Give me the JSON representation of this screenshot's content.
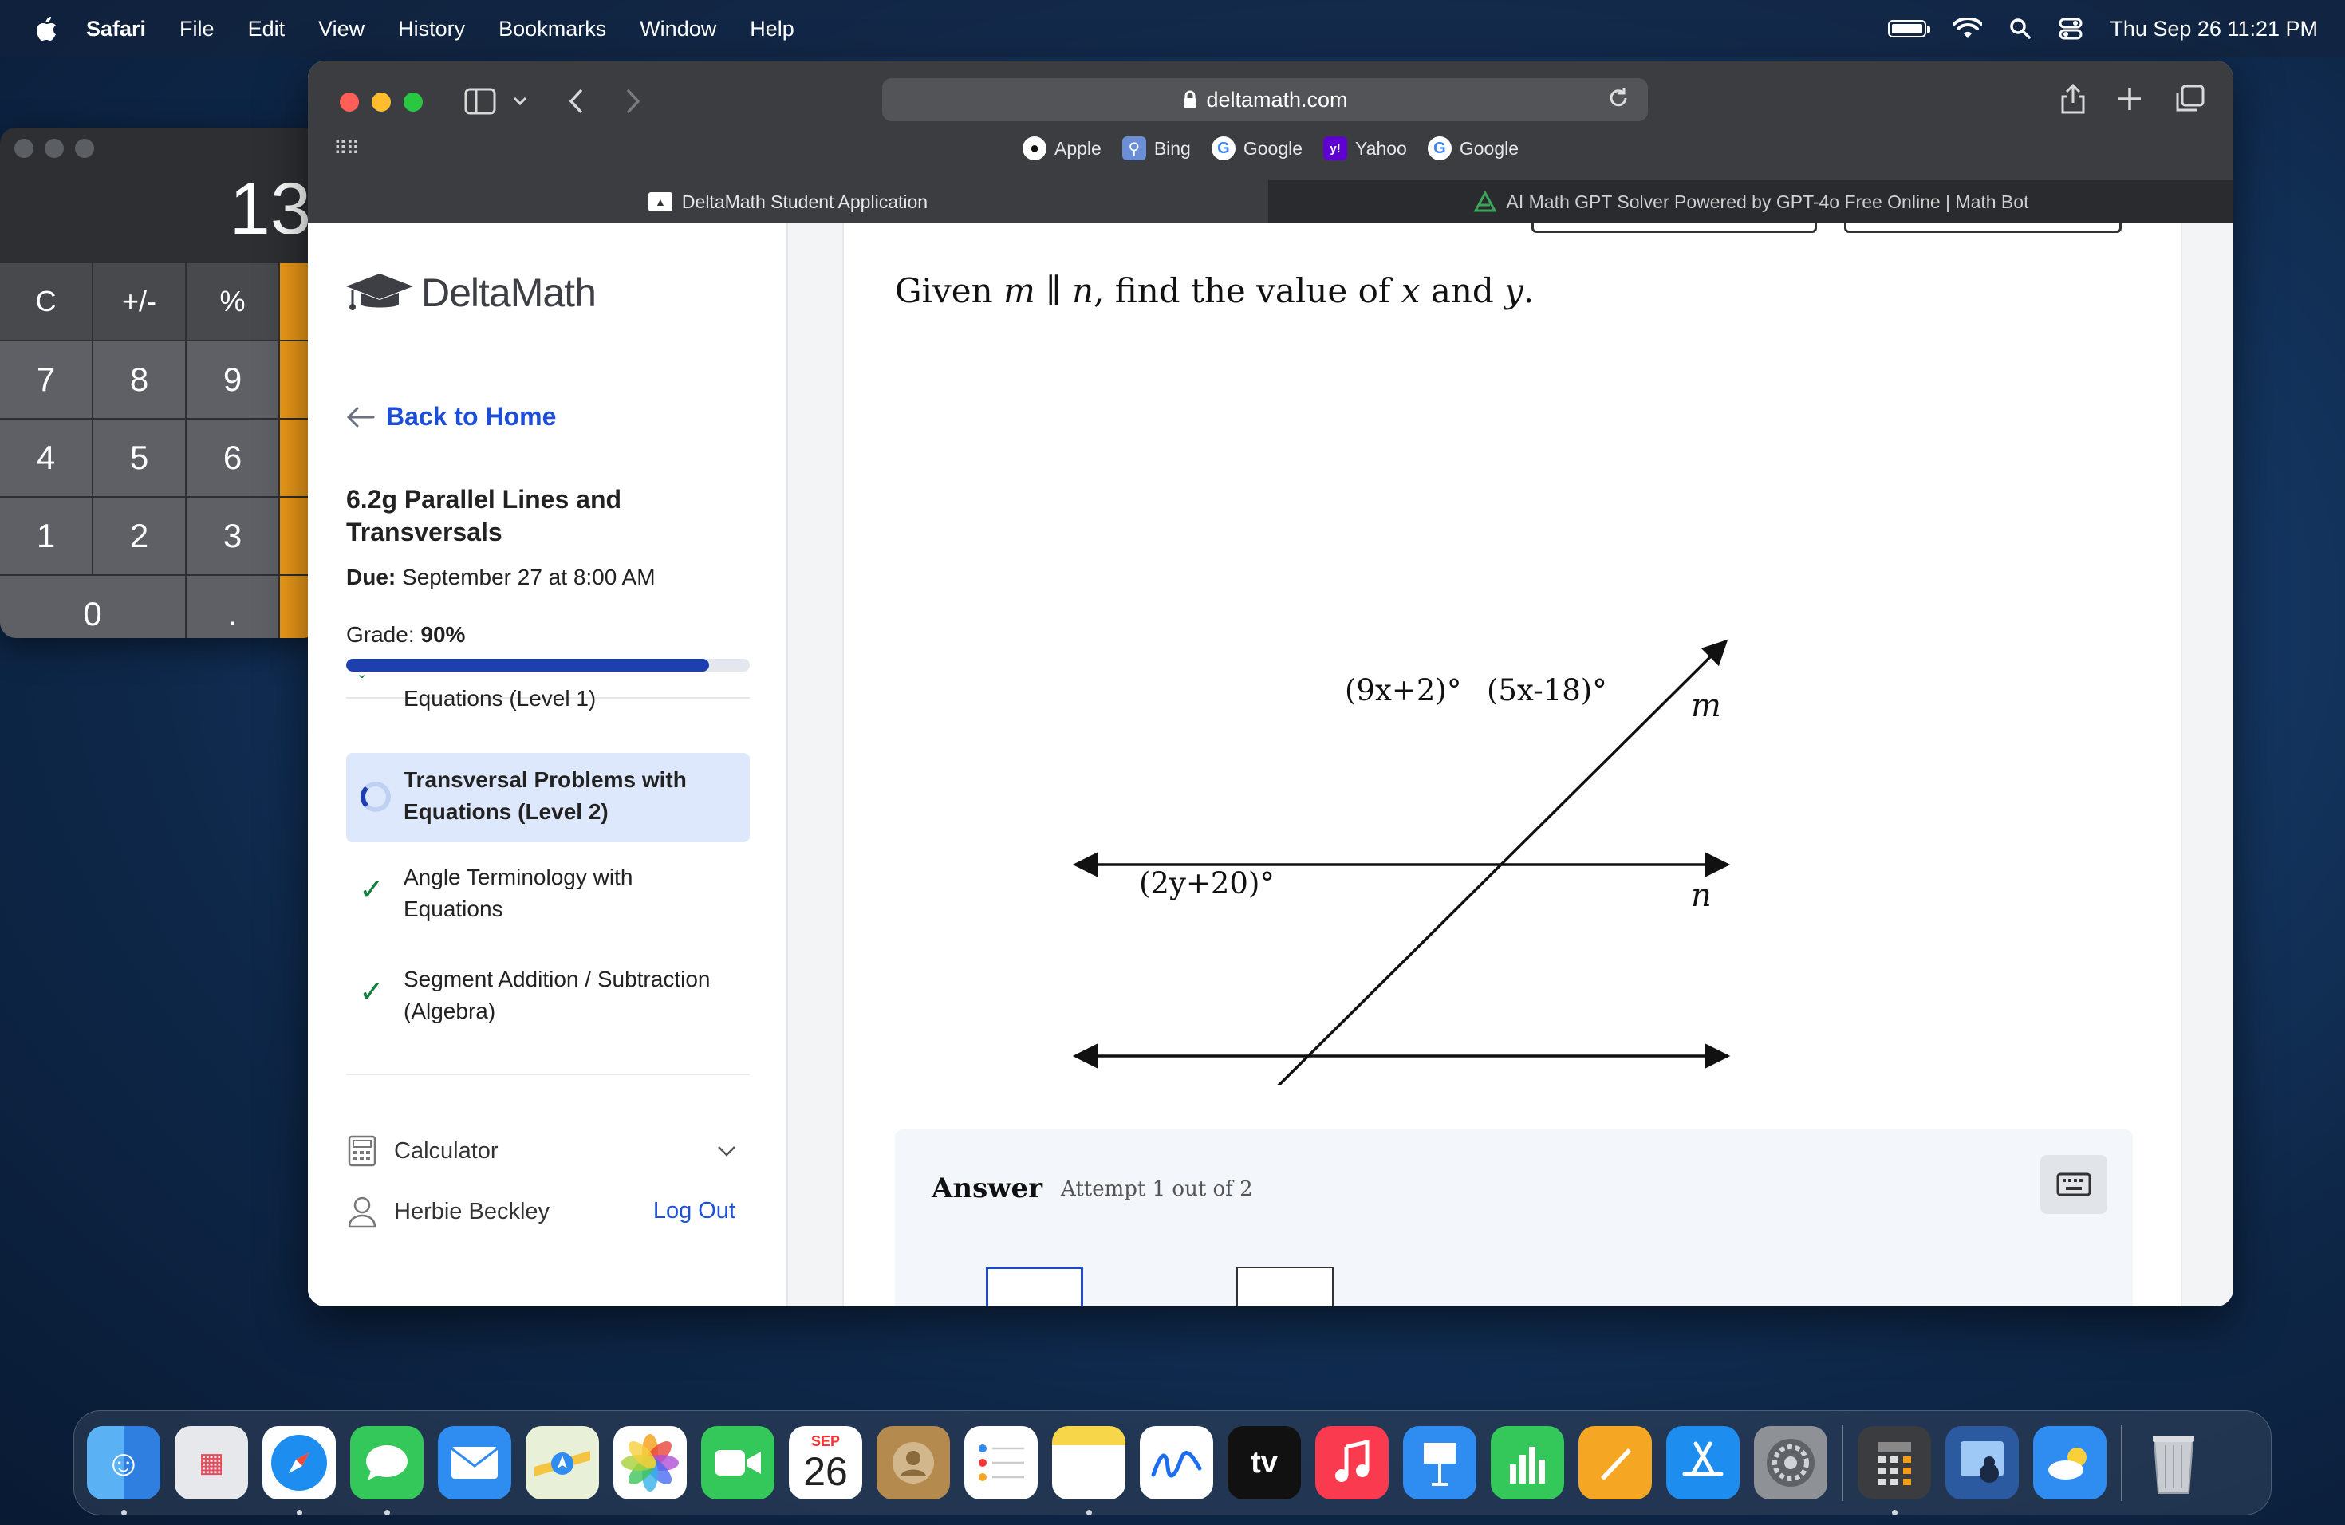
{
  "menubar": {
    "app_name": "Safari",
    "menus": [
      "File",
      "Edit",
      "View",
      "History",
      "Bookmarks",
      "Window",
      "Help"
    ],
    "clock": "Thu Sep 26  11:21 PM"
  },
  "calculator": {
    "display": "13",
    "keys": [
      "C",
      "+/-",
      "%",
      "7",
      "8",
      "9",
      "4",
      "5",
      "6",
      "1",
      "2",
      "3",
      "0",
      "."
    ]
  },
  "browser": {
    "url": "deltamath.com",
    "favorites": [
      {
        "label": "Apple",
        "icon": "apple-icon"
      },
      {
        "label": "Bing",
        "icon": "bing-icon"
      },
      {
        "label": "Google",
        "icon": "google-icon"
      },
      {
        "label": "Yahoo",
        "icon": "yahoo-icon"
      },
      {
        "label": "Google",
        "icon": "google-icon"
      }
    ],
    "tabs": [
      {
        "label": "DeltaMath Student Application",
        "active": true
      },
      {
        "label": "AI Math GPT Solver Powered by GPT-4o Free Online | Math Bot",
        "active": false
      }
    ]
  },
  "sidebar": {
    "logo_text": "DeltaMath",
    "back_label": "Back to Home",
    "assignment_title": "6.2g Parallel Lines and Transversals",
    "due_label": "Due:",
    "due_value": "September 27 at 8:00 AM",
    "grade_label": "Grade:",
    "grade_value": "90%",
    "grade_fraction": 0.9,
    "skills": [
      {
        "label": "Equations (Level 1)",
        "status": "complete"
      },
      {
        "label": "Transversal Problems with Equations (Level 2)",
        "status": "in-progress"
      },
      {
        "label": "Angle Terminology with Equations",
        "status": "complete"
      },
      {
        "label": "Segment Addition / Subtraction (Algebra)",
        "status": "complete"
      }
    ],
    "calculator_label": "Calculator",
    "user_name": "Herbie Beckley",
    "logout_label": "Log Out"
  },
  "question": {
    "prompt_given": "Given",
    "prompt_m": "m",
    "prompt_parallel": "∥",
    "prompt_n": "n",
    "prompt_rest": ", find the value of",
    "prompt_x": "x",
    "prompt_and": "and",
    "prompt_y": "y",
    "prompt_end": ".",
    "angle_top_left": "(9x+2)°",
    "angle_top_right": "(5x-18)°",
    "angle_bottom": "(2y+20)°",
    "line_m": "m",
    "line_n": "n"
  },
  "answer": {
    "label": "Answer",
    "attempt": "Attempt 1 out of 2"
  },
  "dock": {
    "calendar_month": "SEP",
    "calendar_day": "26",
    "tv_label": "tv"
  }
}
